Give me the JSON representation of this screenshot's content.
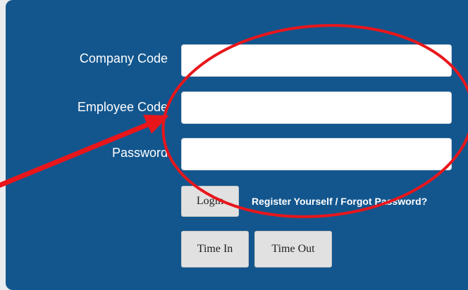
{
  "form": {
    "company_code_label": "Company Code",
    "employee_code_label": "Employee Code",
    "password_label": "Password",
    "company_code_value": "",
    "employee_code_value": "",
    "password_value": ""
  },
  "actions": {
    "login_label": "Login",
    "register_link": "Register Yourself / Forgot Password?",
    "time_in_label": "Time In",
    "time_out_label": "Time Out"
  },
  "colors": {
    "panel": "#13568e",
    "annotation": "#e8161b"
  }
}
